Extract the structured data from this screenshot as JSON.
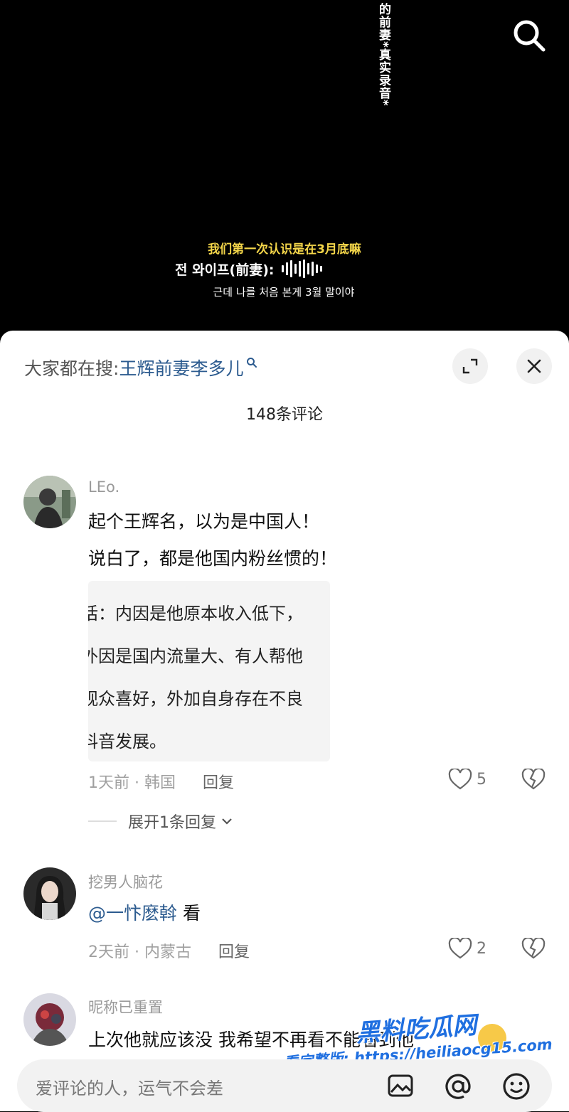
{
  "video": {
    "vertical_title": "的前妻*真实录音*",
    "subtitle_cn": "我们第一次认识是在3月底嘛",
    "speaker": "전 와이프(前妻):",
    "subtitle_kr": "근데 나를 처음 본게 3월 말이야"
  },
  "sheet": {
    "hot_search_prefix": "大家都在搜:",
    "hot_search_term": "王辉前妻李多儿",
    "comment_count": "148条评论"
  },
  "comments": [
    {
      "user": "LEo.",
      "lines": [
        "起个王辉名，以为是中国人！",
        "说白了，都是他国内粉丝惯的！"
      ],
      "image_text": [
        "话：内因是他原本收入低下，",
        "外因是国内流量大、有人帮他",
        "观众喜好，外加自身存在不良",
        "抖音发展。"
      ],
      "time": "1天前 · 韩国",
      "reply": "回复",
      "likes": "5",
      "expand": "展开1条回复"
    },
    {
      "user": "挖男人脑花",
      "mention": "@一忭麽斡",
      "text": " 看",
      "time": "2天前 · 内蒙古",
      "reply": "回复",
      "likes": "2"
    },
    {
      "user": "昵称已重置",
      "text": "上次他就应该没 我希望不再看不能看到他"
    }
  ],
  "input": {
    "placeholder": "爱评论的人，运气不会差"
  },
  "watermark": {
    "line1": "黑料吃瓜网",
    "line2": "看完整版: https://heiliaocg15.com"
  }
}
